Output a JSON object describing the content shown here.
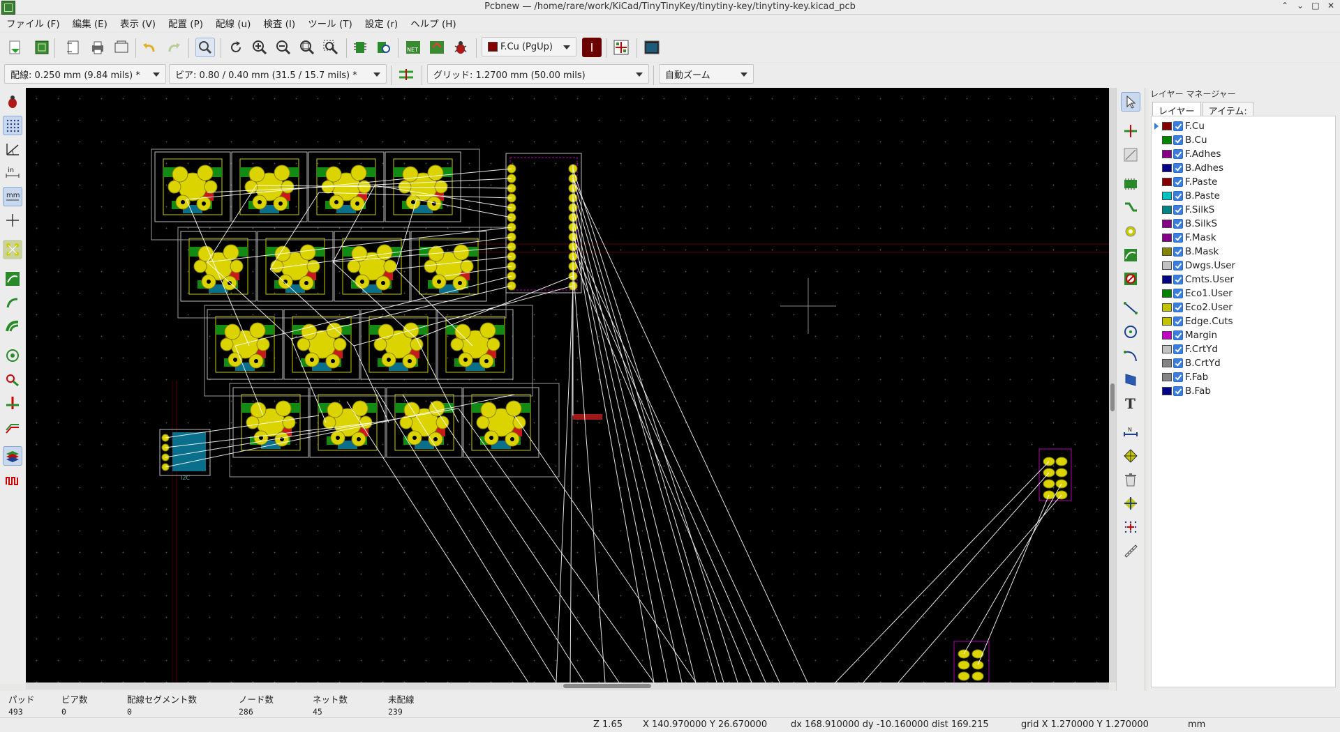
{
  "window": {
    "title": "Pcbnew — /home/rare/work/KiCad/TinyTinyKey/tinytiny-key/tinytiny-key.kicad_pcb"
  },
  "menu": [
    "ファイル (F)",
    "編集 (E)",
    "表示 (V)",
    "配置 (P)",
    "配線 (u)",
    "検査 (I)",
    "ツール (T)",
    "設定 (r)",
    "ヘルプ (H)"
  ],
  "toolbar": {
    "layer_select": "F.Cu (PgUp)",
    "track_width": "配線: 0.250 mm (9.84 mils) *",
    "via_size": "ビア: 0.80 / 0.40 mm (31.5 / 15.7 mils) *",
    "grid": "グリッド: 1.2700 mm (50.00 mils)",
    "zoom": "自動ズーム"
  },
  "layer_manager": {
    "title": "レイヤー マネージャー",
    "tabs": [
      "レイヤー",
      "アイテム:"
    ],
    "layers": [
      {
        "name": "F.Cu",
        "color": "#840000"
      },
      {
        "name": "B.Cu",
        "color": "#008400"
      },
      {
        "name": "F.Adhes",
        "color": "#840084"
      },
      {
        "name": "B.Adhes",
        "color": "#000084"
      },
      {
        "name": "F.Paste",
        "color": "#840000"
      },
      {
        "name": "B.Paste",
        "color": "#00c2c2"
      },
      {
        "name": "F.SilkS",
        "color": "#008484"
      },
      {
        "name": "B.SilkS",
        "color": "#840084"
      },
      {
        "name": "F.Mask",
        "color": "#840084"
      },
      {
        "name": "B.Mask",
        "color": "#848400"
      },
      {
        "name": "Dwgs.User",
        "color": "#c2c2c2"
      },
      {
        "name": "Cmts.User",
        "color": "#000084"
      },
      {
        "name": "Eco1.User",
        "color": "#008400"
      },
      {
        "name": "Eco2.User",
        "color": "#c2c200"
      },
      {
        "name": "Edge.Cuts",
        "color": "#c2c200"
      },
      {
        "name": "Margin",
        "color": "#c200c2"
      },
      {
        "name": "F.CrtYd",
        "color": "#c2c2c2"
      },
      {
        "name": "B.CrtYd",
        "color": "#848484"
      },
      {
        "name": "F.Fab",
        "color": "#848484"
      },
      {
        "name": "B.Fab",
        "color": "#000084"
      }
    ]
  },
  "stats": [
    {
      "label": "パッド",
      "value": "493"
    },
    {
      "label": "ビア数",
      "value": "0"
    },
    {
      "label": "配線セグメント数",
      "value": "0"
    },
    {
      "label": "ノード数",
      "value": "286"
    },
    {
      "label": "ネット数",
      "value": "45"
    },
    {
      "label": "未配線",
      "value": "239"
    }
  ],
  "status": {
    "zoom": "Z 1.65",
    "cursor": "X 140.970000  Y 26.670000",
    "delta": "dx 168.910000  dy -10.160000  dist 169.215",
    "grid": "grid X 1.270000  Y 1.270000",
    "units": "mm"
  },
  "canvas": {
    "labels": [
      "I2C"
    ]
  }
}
